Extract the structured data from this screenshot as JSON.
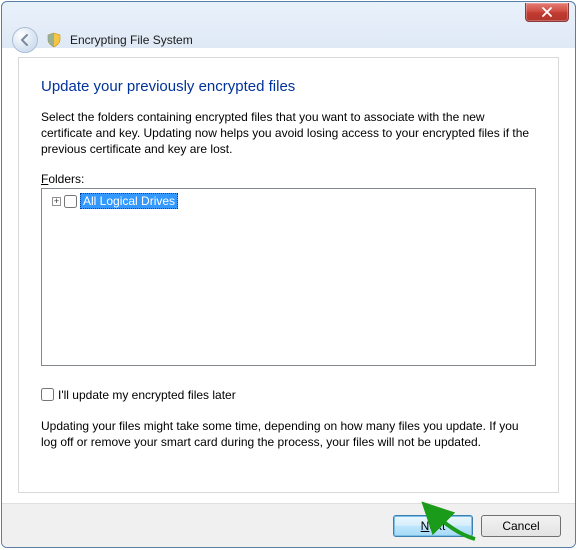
{
  "header": {
    "title": "Encrypting File System"
  },
  "page": {
    "heading": "Update your previously encrypted files",
    "intro": "Select the folders containing encrypted files that you want to associate with the new certificate and key. Updating now helps you avoid losing access to your encrypted files if the previous certificate and key are lost.",
    "folders_label_pre": "F",
    "folders_label_post": "olders:",
    "tree": {
      "root_label": "All Logical Drives",
      "expander_glyph": "+"
    },
    "later_checkbox_label": "I'll update my encrypted files later",
    "note": "Updating your files might take some time, depending on how many files you update. If you log off or remove your smart card during the process, your files will not be updated."
  },
  "footer": {
    "next_pre": "",
    "next_accel": "N",
    "next_post": "ext",
    "cancel": "Cancel"
  }
}
